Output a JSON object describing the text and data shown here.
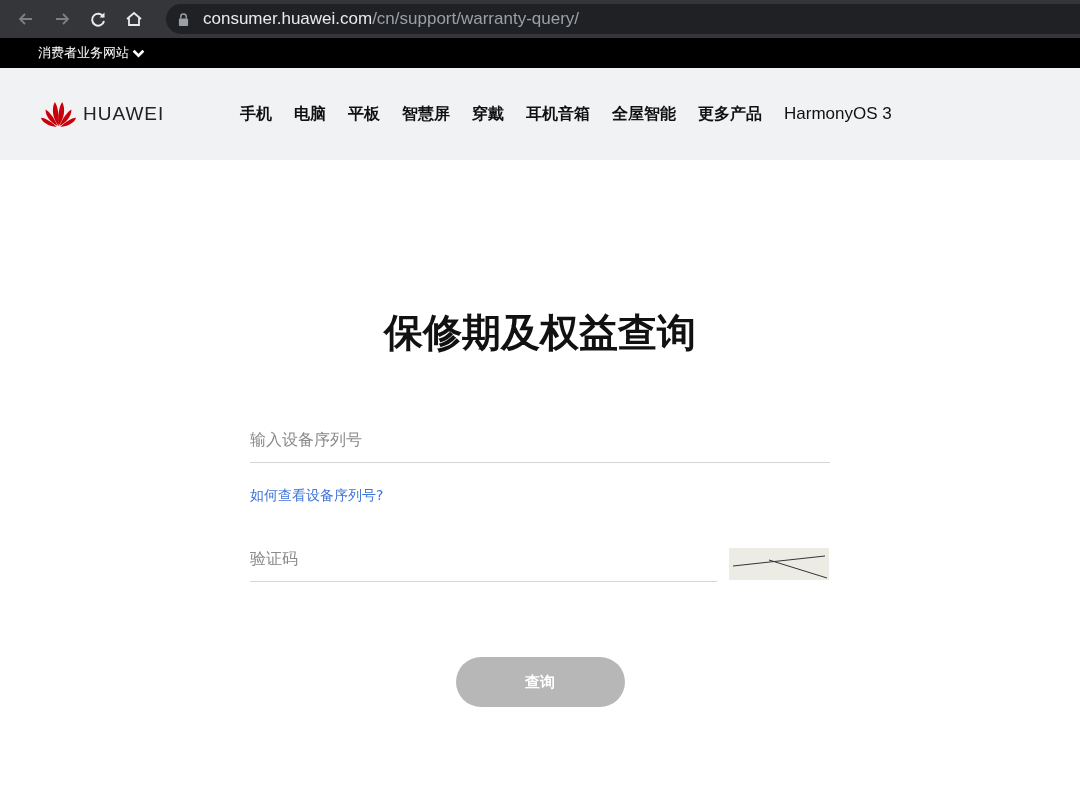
{
  "browser": {
    "url_host": "consumer.huawei.com",
    "url_path": "/cn/support/warranty-query/"
  },
  "top_bar": {
    "site_switch": "消费者业务网站"
  },
  "header": {
    "logo_text": "HUAWEI",
    "nav": [
      "手机",
      "电脑",
      "平板",
      "智慧屏",
      "穿戴",
      "耳机音箱",
      "全屋智能",
      "更多产品",
      "HarmonyOS 3"
    ]
  },
  "form": {
    "title": "保修期及权益查询",
    "serial": {
      "placeholder": "输入设备序列号"
    },
    "help_link": "如何查看设备序列号?",
    "captcha": {
      "placeholder": "验证码"
    },
    "submit": {
      "label": "查询",
      "disabled": true
    }
  }
}
